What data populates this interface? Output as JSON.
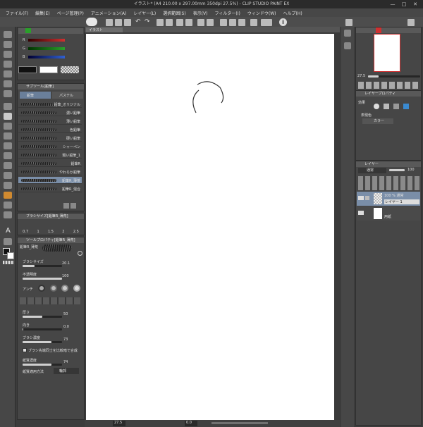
{
  "window": {
    "title": "イラスト* (A4 210.00 x 297.00mm 350dpi 27.5%) - CLIP STUDIO PAINT EX",
    "min": "—",
    "max": "□",
    "close": "✕"
  },
  "menu": [
    "ファイル(F)",
    "編集(E)",
    "ページ管理(P)",
    "アニメーション(A)",
    "レイヤー(L)",
    "選択範囲(S)",
    "表示(V)",
    "フィルター(I)",
    "ウィンドウ(W)",
    "ヘルプ(H)"
  ],
  "canvas_tab": "イラスト",
  "color_panel": {
    "labels": [
      "R",
      "G",
      "B"
    ],
    "values": [
      "",
      "",
      ""
    ]
  },
  "subtool_panel": {
    "header": "サブツール[鉛筆]",
    "tab_pencil": "鉛筆",
    "tab_pastel": "パステル",
    "brushes": [
      "鉛筆_オリジナル",
      "濃い鉛筆",
      "薄い鉛筆",
      "色鉛筆",
      "硬い鉛筆",
      "シャーペン",
      "粗い鉛筆_1",
      "鉛筆R",
      "やわらか鉛筆",
      "鉛筆R_薄荒",
      "鉛筆R_混合"
    ]
  },
  "brushsize_panel": {
    "header": "ブラシサイズ[鉛筆R_薄荒]",
    "sizes": [
      "0.7",
      "1",
      "1.5",
      "2",
      "2.5"
    ]
  },
  "toolprop_panel": {
    "header": "ツールプロパティ[鉛筆R_薄荒]",
    "brush_name": "鉛筆R_薄荒",
    "size_label": "ブラシサイズ",
    "size_value": "20.1",
    "opacity_label": "不透明度",
    "opacity_value": "100",
    "antialias_label": "アンチ",
    "thickness_label": "厚さ",
    "thickness_value": "50",
    "direction_label": "向き",
    "direction_value": "0.0",
    "density_label": "ブラシ濃度",
    "density_value": "73",
    "texture_overlap": "ブラシ先端同士を比較暗で合成",
    "paper_density_label": "紙質濃度",
    "paper_density_value": "74",
    "paper_method_label": "紙質適用方法",
    "paper_method_value": "輪郭"
  },
  "navigator": {
    "zoom": "27.5"
  },
  "layer_property": {
    "header": "レイヤープロパティ",
    "effect_label": "効果",
    "display_color_label": "表現色",
    "display_color_value": "カラー"
  },
  "layers_panel": {
    "header": "レイヤー",
    "blend_mode": "通常",
    "opacity": "100",
    "layers": [
      {
        "line1": "100 % 通常",
        "line2": "レイヤー 1"
      },
      {
        "line1": "",
        "line2": "用紙"
      }
    ]
  },
  "status": {
    "zoom": "27.5",
    "rotation": "0.0"
  },
  "colors": {
    "accent_red": "#d03030",
    "accent_green": "#2aa02a",
    "accent_blue": "#3060d0",
    "selected_row": "#7a8ea8"
  }
}
